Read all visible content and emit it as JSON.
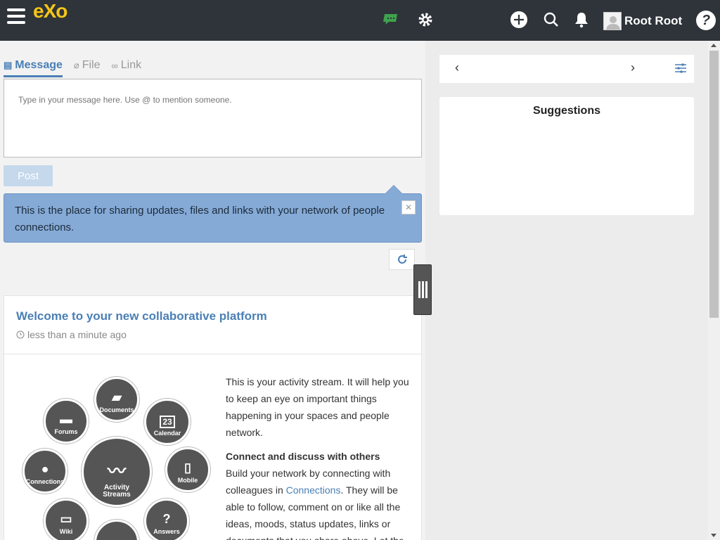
{
  "topbar": {
    "logo": "eXo",
    "user_name": "Root Root",
    "help_label": "?",
    "icons": [
      "menu-icon",
      "chat-icon",
      "gear-icon",
      "add-icon",
      "search-icon",
      "bell-icon",
      "avatar",
      "help-icon"
    ],
    "chat_icon_color": "#3fa34d"
  },
  "composer": {
    "tabs": [
      "Message",
      "File",
      "Link"
    ],
    "placeholder": "Type in your message here. Use @ to mention someone.",
    "post_label": "Post"
  },
  "tip": {
    "text": "This is the place for sharing updates, files and links with your network of people connections.",
    "close_label": "✕"
  },
  "activity": {
    "title": "Welcome to your new collaborative platform",
    "time": "less than a minute ago",
    "apps": [
      "Documents",
      "Forums",
      "Calendar",
      "Connections",
      "Activity Streams",
      "Mobile",
      "Wiki",
      "Answers"
    ],
    "calendar_day": "23",
    "intro": "This is your activity stream. It will help you to keep an eye on important things happening in your spaces and people network.",
    "connect_heading": "Connect and discuss with others",
    "connect_text_1": "Build your network by connecting with colleagues in ",
    "connect_link": "Connections",
    "connect_text_2": ". They will be able to follow, comment on or like all the ideas, moods, status updates, links or documents that you share above. Let the"
  },
  "right": {
    "prev_label": "‹",
    "next_label": "›",
    "suggestions_title": "Suggestions"
  }
}
